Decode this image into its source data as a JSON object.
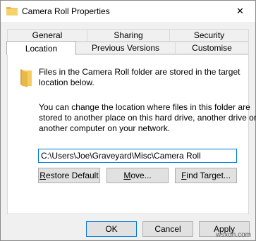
{
  "window": {
    "title": "Camera Roll Properties",
    "close_symbol": "✕"
  },
  "tabs": {
    "row1": [
      "General",
      "Sharing",
      "Security"
    ],
    "row2": [
      "Location",
      "Previous Versions",
      "Customise"
    ],
    "active": "Location"
  },
  "location_tab": {
    "intro_line1": "Files in the Camera Roll folder are stored in the target",
    "intro_line2": "location below.",
    "info_line1": "You can change the location where files in this folder are",
    "info_line2": "stored to another place on this hard drive, another drive or",
    "info_line3": "another computer on your network.",
    "path_value": "C:\\Users\\Joe\\Graveyard\\Misc\\Camera Roll",
    "restore_default": {
      "mnemonic": "R",
      "rest": "estore Default"
    },
    "move": {
      "mnemonic": "M",
      "rest": "ove..."
    },
    "find_target": {
      "mnemonic": "F",
      "rest": "ind Target..."
    }
  },
  "footer": {
    "ok_label": "OK",
    "cancel_label": "Cancel",
    "apply_label": "Apply"
  },
  "watermark": "wsxdn.com",
  "colors": {
    "accent": "#0078d7",
    "folder": "#e8b84a",
    "window_bg": "#f0f0f0"
  }
}
